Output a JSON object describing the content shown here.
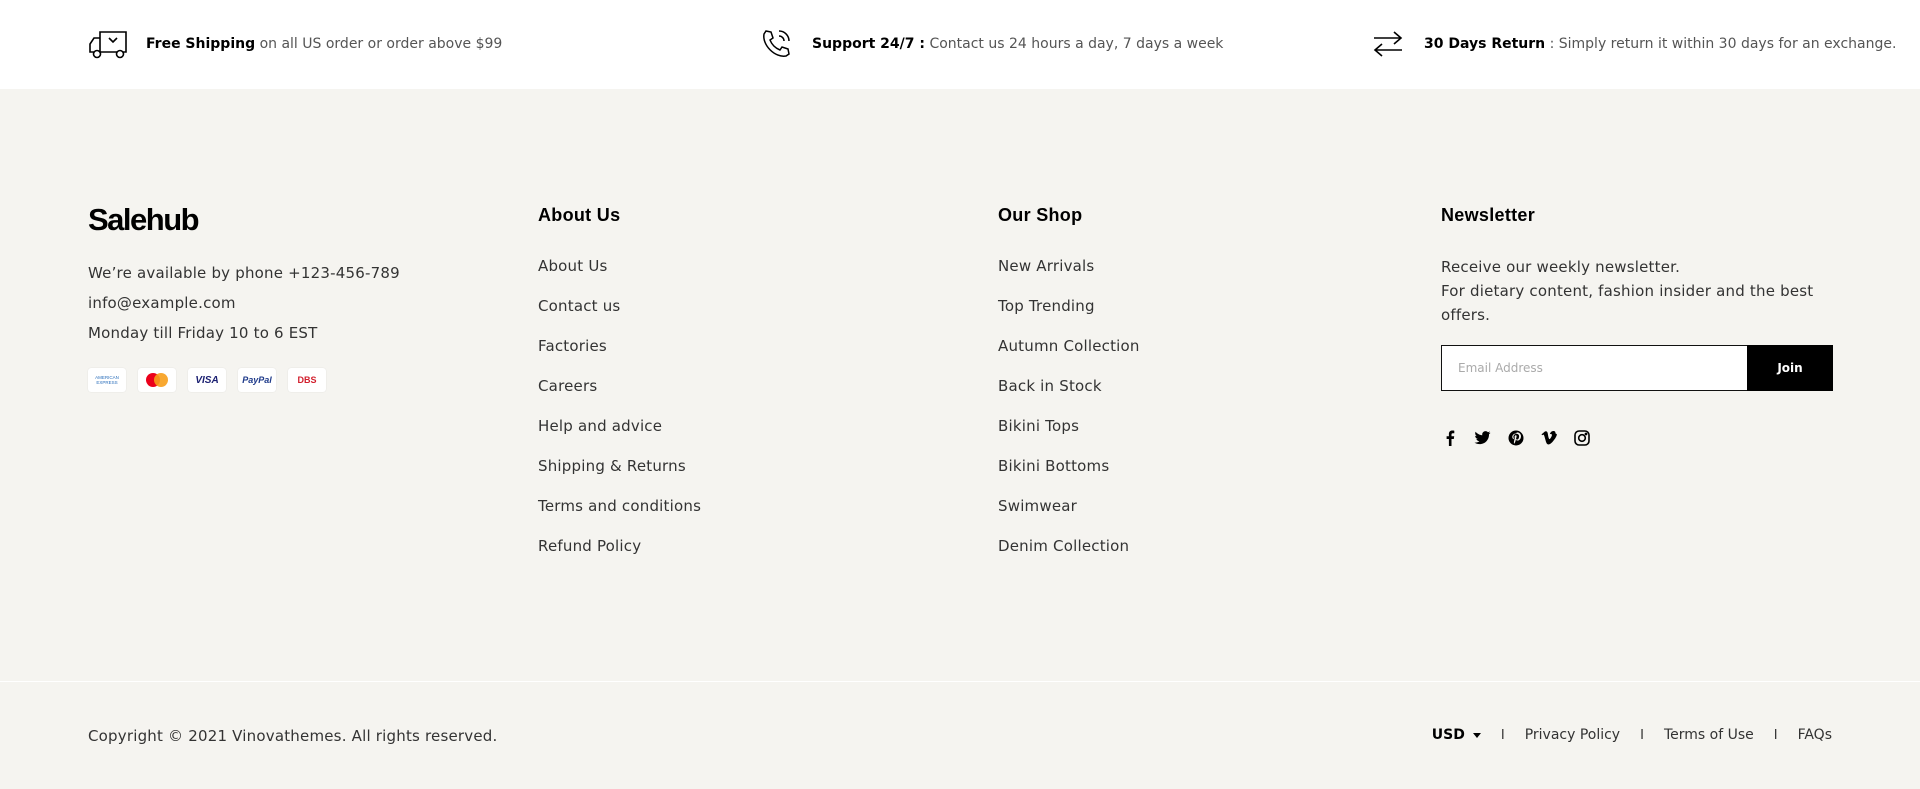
{
  "features": [
    {
      "icon": "truck-icon",
      "title": "Free Shipping",
      "text": " on all US order or order above $99"
    },
    {
      "icon": "phone-icon",
      "title": "Support 24/7 :",
      "text": " Contact us 24 hours a day, 7 days a week"
    },
    {
      "icon": "return-arrows-icon",
      "title": "30 Days Return",
      "text": " : Simply return it within 30 days for an exchange."
    }
  ],
  "brand": {
    "logo": "Salehub",
    "phone_line": "We’re available by phone +123-456-789",
    "email": "info@example.com",
    "hours": "Monday till Friday 10 to 6 EST",
    "payments": [
      {
        "name": "amex-card-icon",
        "label": "AMERICAN EXPRESS"
      },
      {
        "name": "mastercard-icon",
        "label": ""
      },
      {
        "name": "visa-card-icon",
        "label": "VISA"
      },
      {
        "name": "paypal-card-icon",
        "label": "PayPal"
      },
      {
        "name": "dbs-card-icon",
        "label": "DBS"
      }
    ]
  },
  "about": {
    "title": "About Us",
    "links": [
      "About Us",
      "Contact us",
      "Factories",
      "Careers",
      "Help and advice",
      "Shipping & Returns",
      "Terms and conditions",
      "Refund Policy"
    ]
  },
  "shop": {
    "title": "Our Shop",
    "links": [
      "New Arrivals",
      "Top Trending",
      "Autumn Collection",
      "Back in Stock",
      "Bikini Tops",
      "Bikini Bottoms",
      "Swimwear",
      "Denim Collection"
    ]
  },
  "newsletter": {
    "title": "Newsletter",
    "line1": "Receive our weekly newsletter.",
    "line2": "For dietary content, fashion insider and the best offers.",
    "placeholder": "Email Address",
    "value": "",
    "button": "Join",
    "socials": [
      "facebook-icon",
      "twitter-icon",
      "pinterest-icon",
      "vimeo-icon",
      "instagram-icon"
    ]
  },
  "bottom": {
    "copyright": "Copyright © 2021 Vinovathemes. All rights reserved.",
    "currency": "USD",
    "separator": "I",
    "links": [
      "Privacy Policy",
      "Terms of Use",
      "FAQs"
    ]
  },
  "colors": {
    "top_bar": "#ffffff",
    "footer_bg": "#f5f4f0",
    "button_bg": "#000000",
    "mastercard_red": "#eb001b",
    "mastercard_yellow": "#f79e1b"
  }
}
